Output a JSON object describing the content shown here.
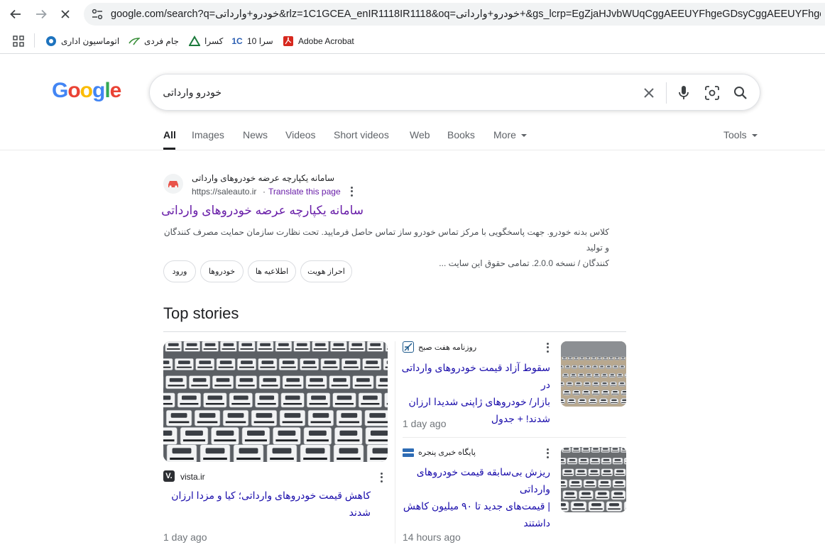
{
  "browser": {
    "url": "google.com/search?q=خودرو+وارداتی&rlz=1C1GCEA_enIR1118IR1118&oq=خودرو+وارداتی+&gs_lcrp=EgZjaHJvbWUqCggAEEUYFhgeGDsyCggAEEUYFhgeGDsyBwgB",
    "bookmarks": [
      {
        "label": "اتوماسیون اداری",
        "icon": "automation-icon"
      },
      {
        "label": "جام فردی",
        "icon": "jam-icon"
      },
      {
        "label": "کسرا",
        "icon": "kasra-icon"
      },
      {
        "label": "سرا 10",
        "icon": "sara-icon"
      },
      {
        "label": "Adobe Acrobat",
        "icon": "acrobat-icon"
      }
    ]
  },
  "search": {
    "query": "خودرو وارداتی"
  },
  "tabs": [
    "All",
    "Images",
    "News",
    "Videos",
    "Short videos",
    "Web",
    "Books",
    "More",
    "Tools"
  ],
  "result": {
    "site_name": "سامانه یکپارچه عرضه خودروهای وارداتی",
    "site_url": "https://saleauto.ir",
    "translate": "Translate this page",
    "title": "سامانه یکپارچه عرضه خودروهای وارداتی",
    "snippet_line1": "کلاس بدنه خودرو. جهت پاسخگویی با مرکز تماس خودرو ساز تماس حاصل فرمایید. تحت نظارت سازمان حمایت مصرف کنندگان و تولید",
    "snippet_line2": "کنندگان / نسخه 2.0.0. تمامی حقوق این سایت ...",
    "chips": [
      "احراز هویت",
      "اطلاعیه ها",
      "خودروها",
      "ورود"
    ]
  },
  "top_stories": {
    "heading": "Top stories",
    "stories": [
      {
        "source": "vista.ir",
        "title": "کاهش قیمت خودروهای وارداتی؛ کیا و مزدا ارزان شدند",
        "time": "1 day ago"
      },
      {
        "source": "روزنامه هفت صبح",
        "title_line1": "سقوط آزاد قیمت خودروهای وارداتی در",
        "title_line2": "بازار/ خودروهای ژاپنی شدیدا ارزان",
        "title_line3": "شدند! + جدول",
        "time": "1 day ago"
      },
      {
        "source": "پایگاه خبری پنجره",
        "title_line1": "ریزش بی‌سابقه قیمت خودروهای وارداتی",
        "title_line2": "| قیمت‌های جدید تا ۹۰ میلیون کاهش",
        "title_line3": "داشتند",
        "time": "14 hours ago"
      }
    ]
  },
  "colors": {
    "link": "#1a0dab",
    "visited": "#681da8",
    "google_blue": "#4285f4",
    "google_red": "#ea4335",
    "google_yellow": "#fbbc05",
    "google_green": "#34a853"
  }
}
